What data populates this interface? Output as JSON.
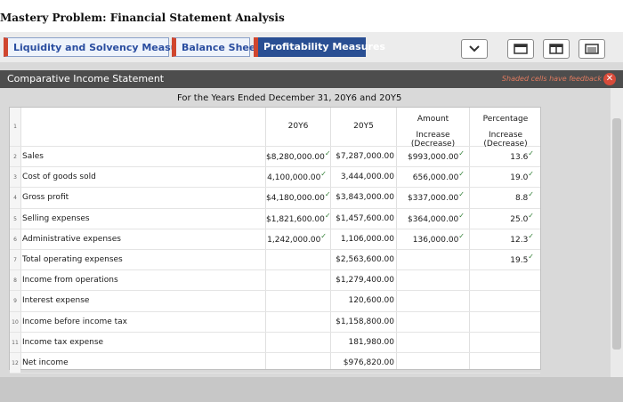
{
  "page_title": "Mastery Problem: Financial Statement Analysis",
  "tabs": [
    {
      "label": "Liquidity and Solvency Measures",
      "active": false
    },
    {
      "label": "Balance Sheet",
      "active": false
    },
    {
      "label": "Profitability Measures",
      "active": true
    }
  ],
  "toolbar": {
    "icons": [
      "chevron-down-icon",
      "window-icon",
      "split-view-icon",
      "full-view-icon"
    ]
  },
  "panel": {
    "title": "Comparative Income Statement",
    "feedback_note": "Shaded cells have feedback",
    "close_symbol": "✕"
  },
  "statement": {
    "subtitle": "For the Years Ended December 31, 20Y6 and 20Y5",
    "headers": {
      "row_num": "1",
      "col_2016": "20Y6",
      "col_2015": "20Y5",
      "col_amount_1": "Amount",
      "col_amount_2": "Increase (Decrease)",
      "col_pct_1": "Percentage",
      "col_pct_2": "Increase (Decrease)"
    },
    "rows": [
      {
        "n": "2",
        "label": "Sales",
        "y6": "$8,280,000.00",
        "y5": "$7,287,000.00",
        "amt": "$993,000.00",
        "pct": "13.6"
      },
      {
        "n": "3",
        "label": "Cost of goods sold",
        "y6": "4,100,000.00",
        "y5": "3,444,000.00",
        "amt": "656,000.00",
        "pct": "19.0"
      },
      {
        "n": "4",
        "label": "Gross profit",
        "y6": "$4,180,000.00",
        "y5": "$3,843,000.00",
        "amt": "$337,000.00",
        "pct": "8.8"
      },
      {
        "n": "5",
        "label": "Selling expenses",
        "y6": "$1,821,600.00",
        "y5": "$1,457,600.00",
        "amt": "$364,000.00",
        "pct": "25.0"
      },
      {
        "n": "6",
        "label": "Administrative expenses",
        "y6": "1,242,000.00",
        "y5": "1,106,000.00",
        "amt": "136,000.00",
        "pct": "12.3"
      },
      {
        "n": "7",
        "label": "Total operating expenses",
        "y6": "",
        "y5": "$2,563,600.00",
        "amt": "",
        "pct": "19.5"
      },
      {
        "n": "8",
        "label": "Income from operations",
        "y6": "",
        "y5": "$1,279,400.00",
        "amt": "",
        "pct": ""
      },
      {
        "n": "9",
        "label": "Interest expense",
        "y6": "",
        "y5": "120,600.00",
        "amt": "",
        "pct": ""
      },
      {
        "n": "10",
        "label": "Income before income tax",
        "y6": "",
        "y5": "$1,158,800.00",
        "amt": "",
        "pct": ""
      },
      {
        "n": "11",
        "label": "Income tax expense",
        "y6": "",
        "y5": "181,980.00",
        "amt": "",
        "pct": ""
      },
      {
        "n": "12",
        "label": "Net income",
        "y6": "",
        "y5": "$976,820.00",
        "amt": "",
        "pct": ""
      }
    ]
  },
  "colors": {
    "tab_accent": "#d0462e",
    "tab_active_bg": "#2a4f93",
    "tab_text": "#2b4ea0",
    "header_bar": "#4d4d4d",
    "check": "#2e7d32"
  }
}
